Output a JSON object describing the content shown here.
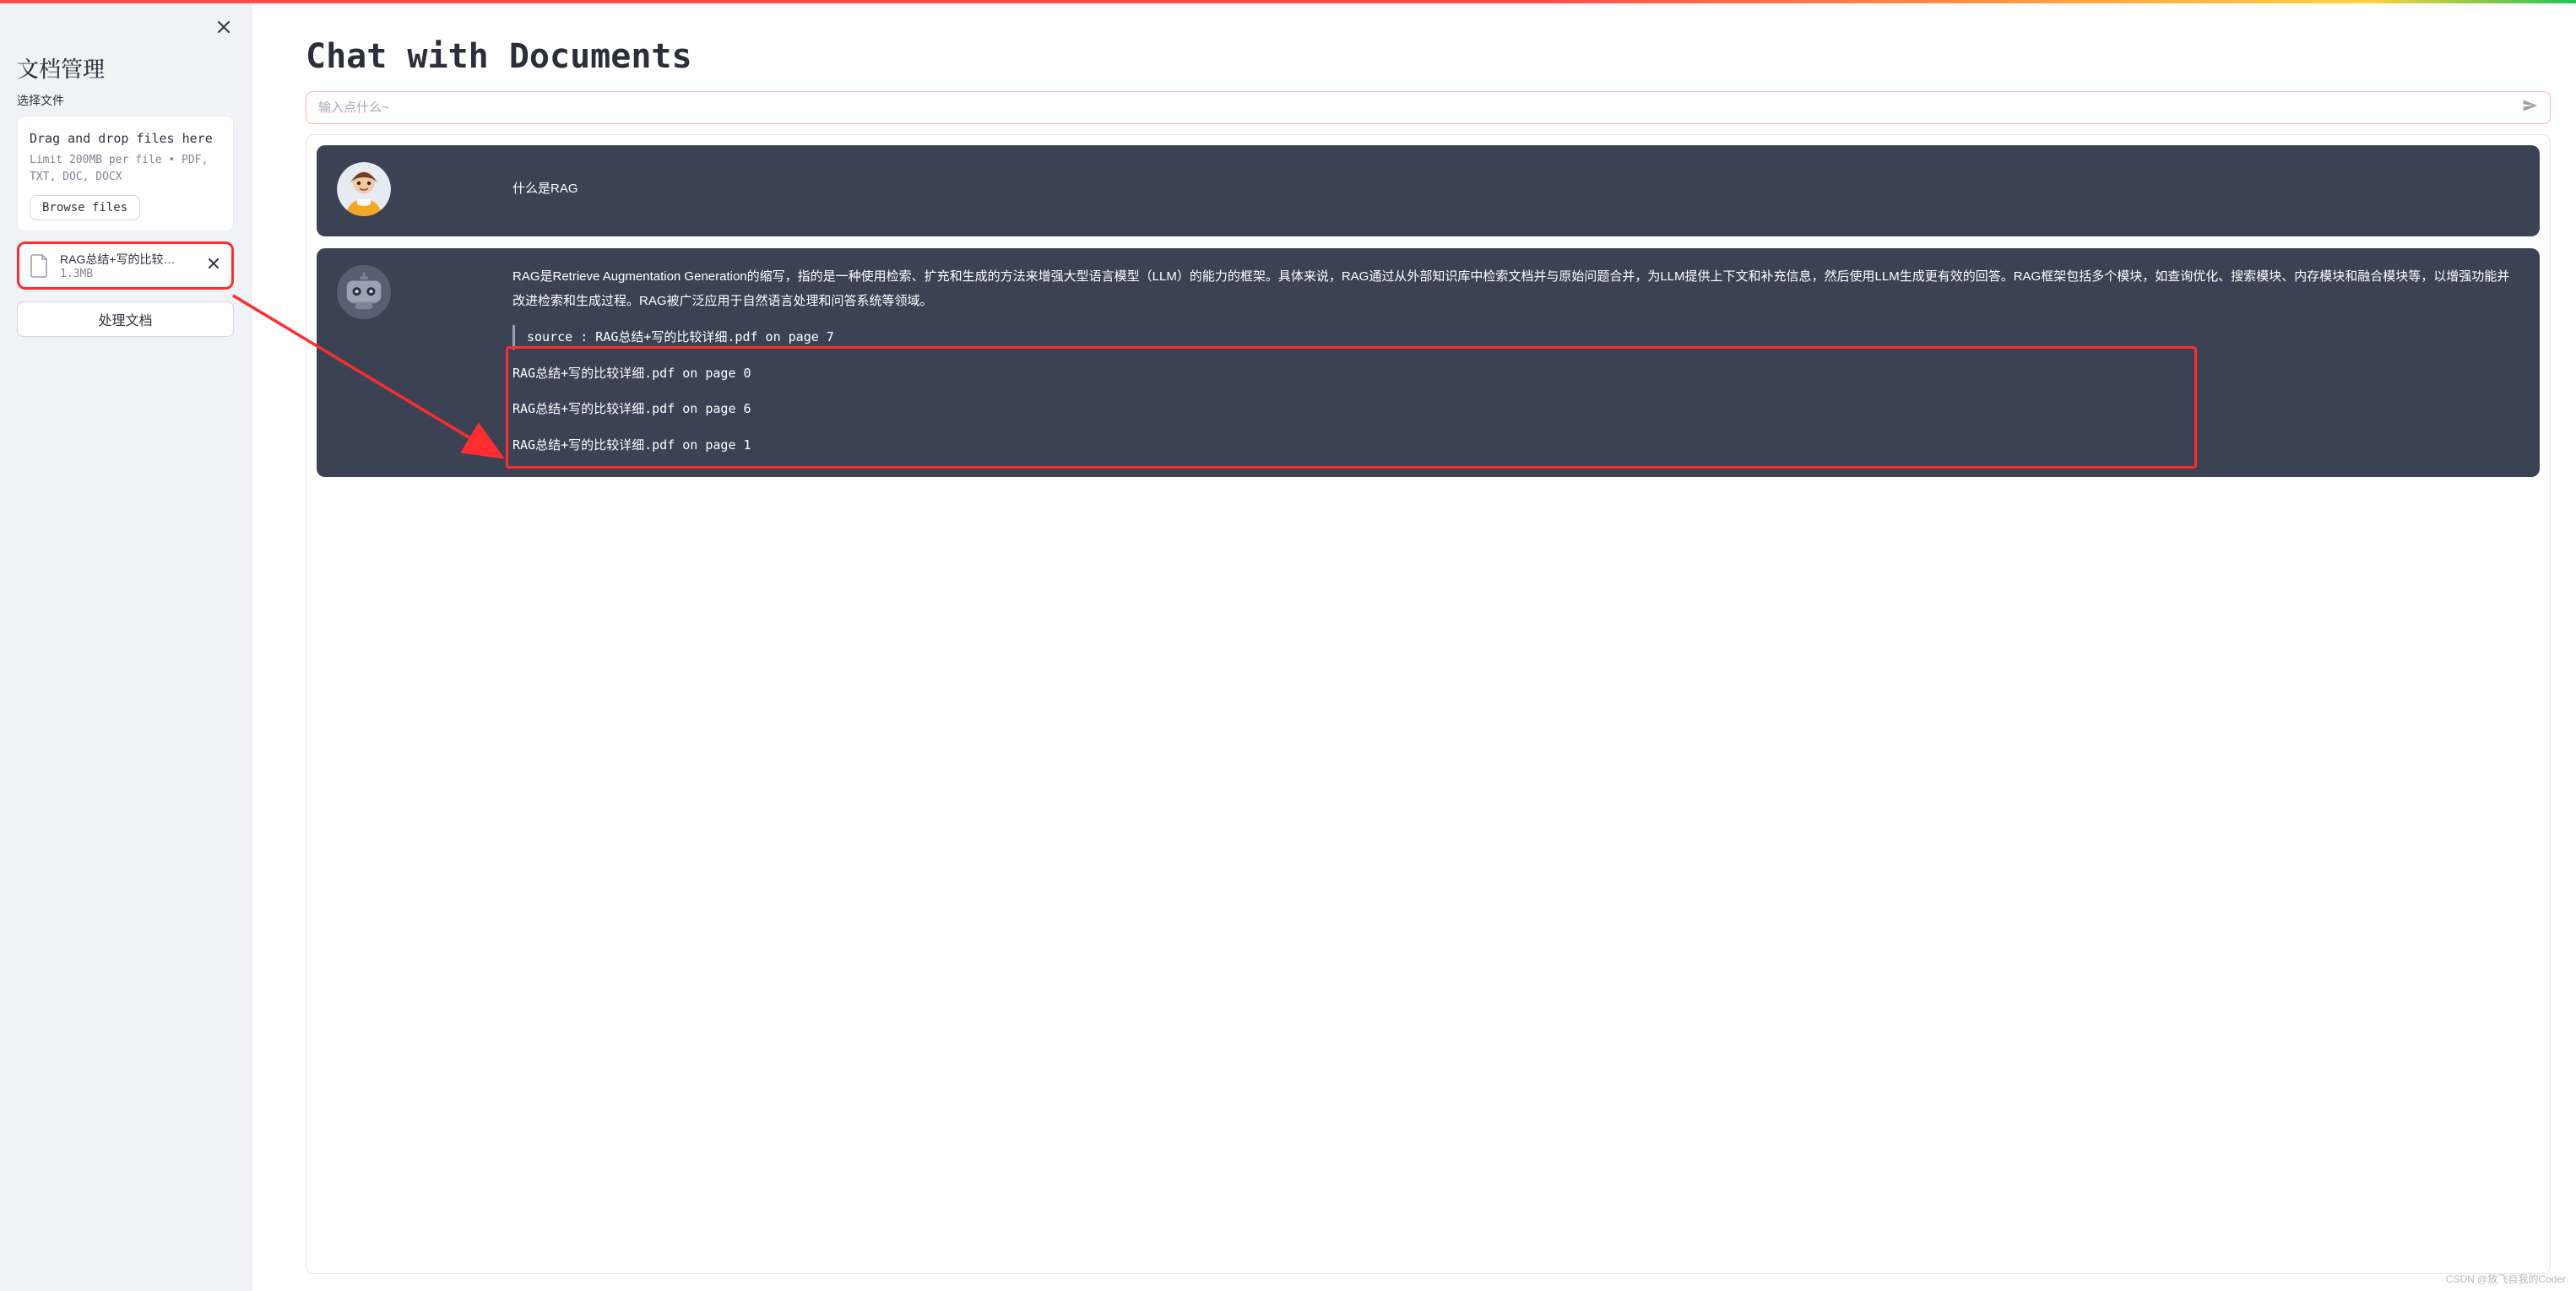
{
  "sidebar": {
    "title": "文档管理",
    "select_label": "选择文件",
    "drag_text": "Drag and drop files here",
    "limit_text": "Limit 200MB per file • PDF, TXT, DOC, DOCX",
    "browse_label": "Browse files",
    "file": {
      "name": "RAG总结+写的比较…",
      "size": "1.3MB"
    },
    "process_label": "处理文档"
  },
  "main": {
    "title": "Chat with Documents",
    "input_placeholder": "输入点什么~"
  },
  "chat": {
    "user_msg": "什么是RAG",
    "bot_answer": "RAG是Retrieve Augmentation Generation的缩写，指的是一种使用检索、扩充和生成的方法来增强大型语言模型（LLM）的能力的框架。具体来说，RAG通过从外部知识库中检索文档并与原始问题合并，为LLM提供上下文和补充信息，然后使用LLM生成更有效的回答。RAG框架包括多个模块，如查询优化、搜索模块、内存模块和融合模块等，以增强功能并改进检索和生成过程。RAG被广泛应用于自然语言处理和问答系统等领域。",
    "bot_source_quoted": "source : RAG总结+写的比较详细.pdf on page 7",
    "bot_sources": [
      "RAG总结+写的比较详细.pdf on page 0",
      "RAG总结+写的比较详细.pdf on page 6",
      "RAG总结+写的比较详细.pdf on page 1"
    ]
  },
  "watermark": "CSDN @放飞自我的Coder"
}
